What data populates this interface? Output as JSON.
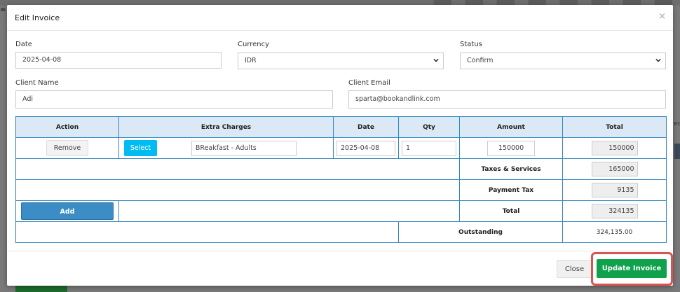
{
  "modal": {
    "title": "Edit Invoice",
    "close_glyph": "×"
  },
  "form": {
    "date_label": "Date",
    "date_value": "2025-04-08",
    "currency_label": "Currency",
    "currency_value": "IDR",
    "status_label": "Status",
    "status_value": "Confirm",
    "client_name_label": "Client Name",
    "client_name_value": "Adi",
    "client_email_label": "Client Email",
    "client_email_value": "sparta@bookandlink.com"
  },
  "table": {
    "headers": [
      "Action",
      "Extra Charges",
      "Date",
      "Qty",
      "Amount",
      "Total"
    ],
    "row": {
      "remove_label": "Remove",
      "select_label": "Select",
      "charge_name": "BReakfast - Adults",
      "date": "2025-04-08",
      "qty": "1",
      "amount": "150000",
      "total": "150000"
    },
    "taxes_label": "Taxes & Services",
    "taxes_value": "165000",
    "payment_tax_label": "Payment Tax",
    "payment_tax_value": "9135",
    "add_label": "Add",
    "total_label": "Total",
    "total_value": "324135",
    "outstanding_label": "Outstanding",
    "outstanding_value": "324,135.00"
  },
  "footer": {
    "close_label": "Close",
    "update_label": "Update Invoice"
  },
  "colors": {
    "header_bg": "#dbe9f6",
    "table_border": "#2e86c1",
    "select_btn": "#00bcf2",
    "add_btn": "#3c8dc5",
    "update_btn": "#0fa14b",
    "highlight": "#d9534f"
  },
  "icons": {
    "menu": "menu-icon",
    "dropdown": "chevron-down-icon",
    "close": "close-icon"
  },
  "background": {
    "menu_glyph": "≡",
    "right_text": "ec"
  }
}
